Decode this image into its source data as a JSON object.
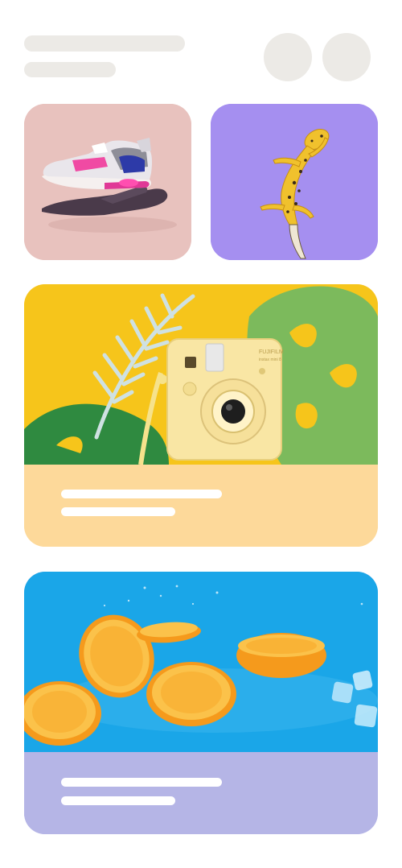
{
  "header": {
    "skeleton_lines": 2,
    "avatars": [
      "avatar-placeholder-1",
      "avatar-placeholder-2"
    ]
  },
  "colors": {
    "skeleton": "#eceae6",
    "card_pink": "#e8c2be",
    "card_purple": "#a58ff0",
    "camera_bg": "#f6c51b",
    "camera_footer": "#fdd99a",
    "orange_bg": "#1aa6e8",
    "orange_footer": "#b5b5e6"
  },
  "cards": [
    {
      "id": "sneaker",
      "icon": "sneaker-image"
    },
    {
      "id": "gecko",
      "icon": "gecko-image"
    },
    {
      "id": "camera",
      "icon": "instant-camera-image",
      "camera_brand": "FUJIFILM",
      "camera_model": "instax mini 8"
    },
    {
      "id": "oranges",
      "icon": "orange-slices-image"
    }
  ]
}
